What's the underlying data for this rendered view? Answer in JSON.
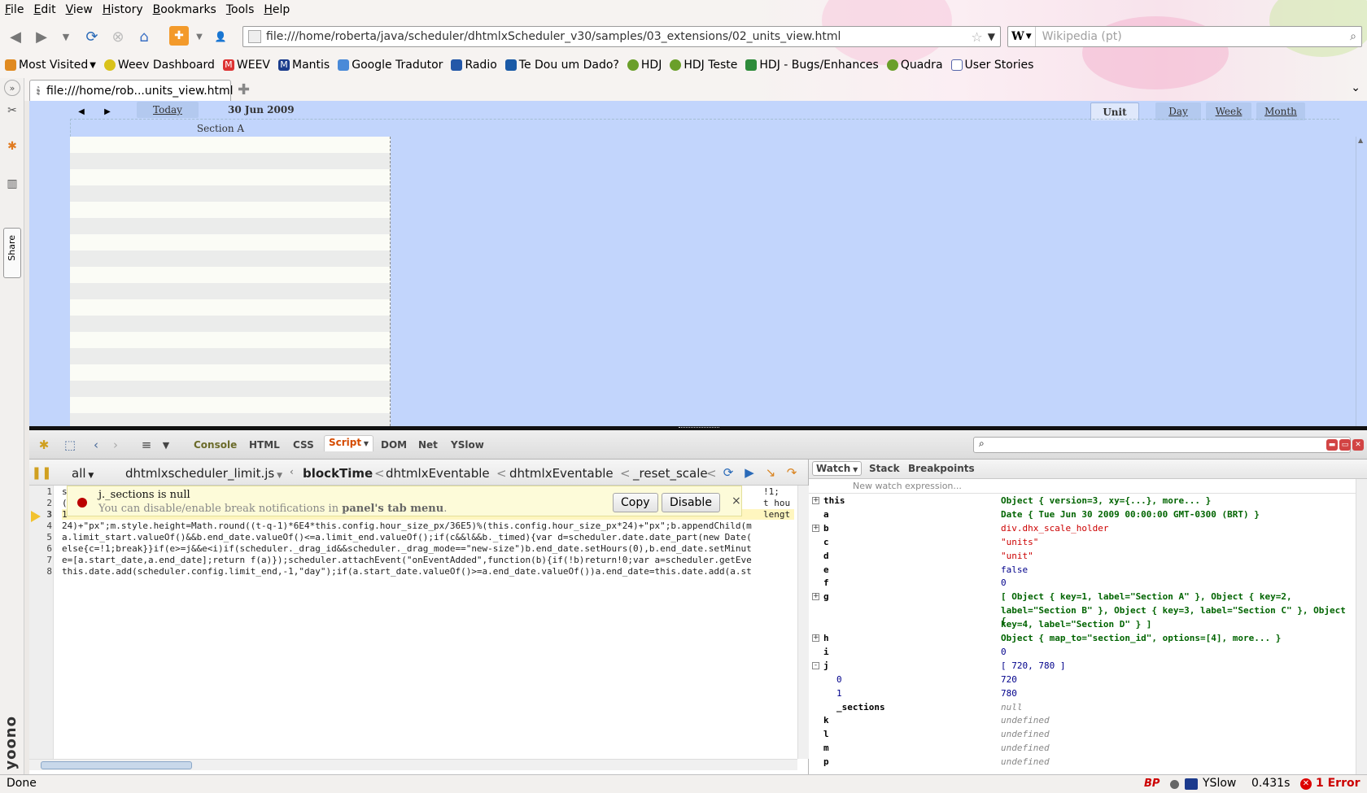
{
  "menu": [
    "File",
    "Edit",
    "View",
    "History",
    "Bookmarks",
    "Tools",
    "Help"
  ],
  "urlbar": {
    "url": "file:///home/roberta/java/scheduler/dhtmlxScheduler_v30/samples/03_extensions/02_units_view.html"
  },
  "search": {
    "engine": "W",
    "placeholder": "Wikipedia (pt)"
  },
  "bookmarks": [
    "Most Visited",
    "Weev Dashboard",
    "WEEV",
    "Mantis",
    "Google Tradutor",
    "Radio",
    "Te Dou um Dado?",
    "HDJ",
    "HDJ Teste",
    "HDJ - Bugs/Enhances",
    "Quadra",
    "User Stories"
  ],
  "tab": {
    "title": "file:///home/rob...units_view.html"
  },
  "sidebar": {
    "share_label": "Share",
    "brand": "yoono"
  },
  "scheduler": {
    "today_label": "Today",
    "date_label": "30 Jun 2009",
    "views": [
      "Unit",
      "Day",
      "Week",
      "Month"
    ],
    "active_view": "Unit",
    "section_label": "Section A"
  },
  "firebug": {
    "panels": [
      "Console",
      "HTML",
      "CSS",
      "Script",
      "DOM",
      "Net",
      "YSlow"
    ],
    "active_panel": "Script",
    "script_filter": "all",
    "script_file": "dhtmlxscheduler_limit.js",
    "callstack": [
      "blockTime",
      "dhtmlxEventable",
      "dhtmlxEventable",
      "_reset_scale"
    ],
    "line_numbers": [
      "1",
      "2",
      "3",
      "4",
      "5",
      "6",
      "7",
      "8"
    ],
    "code_lines": [
      "s",
      "(",
      "1",
      "24)+\"px\";m.style.height=Math.round((t-q-1)*6E4*this.config.hour_size_px/36E5)%(this.config.hour_size_px*24)+\"px\";b.appendChild(m",
      "a.limit_start.valueOf()&&b.end_date.valueOf()<=a.limit_end.valueOf();if(c&&l&&b._timed){var d=scheduler.date.date_part(new Date(",
      "else{c=!1;break}}if(e>=j&&e<i)if(scheduler._drag_id&&scheduler._drag_mode==\"new-size\")b.end_date.setHours(0),b.end_date.setMinut",
      "e=[a.start_date,a.end_date];return f(a)});scheduler.attachEvent(\"onEventAdded\",function(b){if(!b)return!0;var a=scheduler.getEve",
      "this.date.add(scheduler.config.limit_end,-1,\"day\");if(a.start_date.valueOf()>=a.end_date.valueOf())a.end_date=this.date.add(a.st"
    ],
    "code_right_fragments": [
      "!1;",
      "t hou",
      "lengt"
    ],
    "notification": {
      "message": "j._sections is null",
      "hint_prefix": "You can disable/enable break notifications in",
      "hint_bold": "panel's tab menu",
      "hint_suffix": ".",
      "copy_label": "Copy",
      "disable_label": "Disable",
      "close": "×"
    },
    "watch_tabs": [
      "Watch",
      "Stack",
      "Breakpoints"
    ],
    "new_watch_placeholder": "New watch expression...",
    "watch": [
      {
        "name": "this",
        "value": "Object { version=3,  xy={...},  more... }",
        "kind": "obj",
        "expand": "+"
      },
      {
        "name": "a",
        "value": "Date { Tue Jun 30 2009 00:00:00 GMT-0300 (BRT) }",
        "kind": "obj",
        "expand": ""
      },
      {
        "name": "b",
        "value": "div.dhx_scale_holder",
        "kind": "dom",
        "expand": "+"
      },
      {
        "name": "c",
        "value": "\"units\"",
        "kind": "str",
        "expand": ""
      },
      {
        "name": "d",
        "value": "\"unit\"",
        "kind": "str",
        "expand": ""
      },
      {
        "name": "e",
        "value": "false",
        "kind": "num",
        "expand": ""
      },
      {
        "name": "f",
        "value": "0",
        "kind": "num",
        "expand": ""
      },
      {
        "name": "g",
        "value": "[ Object { key=1,  label=\"Section A\" },  Object { key=2,",
        "kind": "obj",
        "expand": "+"
      },
      {
        "name": "",
        "value": "label=\"Section B\" },  Object { key=3,  label=\"Section C\" },  Object {",
        "kind": "obj",
        "expand": ""
      },
      {
        "name": "",
        "value": "key=4,  label=\"Section D\" } ]",
        "kind": "obj",
        "expand": ""
      },
      {
        "name": "h",
        "value": "Object { map_to=\"section_id\",  options=[4],  more... }",
        "kind": "obj",
        "expand": "+"
      },
      {
        "name": "i",
        "value": "0",
        "kind": "num",
        "expand": ""
      },
      {
        "name": "j",
        "value": "[ 720,  780 ]",
        "kind": "num",
        "expand": "-"
      },
      {
        "name": "0",
        "value": "720",
        "kind": "num",
        "expand": "",
        "indent": true
      },
      {
        "name": "1",
        "value": "780",
        "kind": "num",
        "expand": "",
        "indent": true
      },
      {
        "name": "_sections",
        "value": "null",
        "kind": "nul",
        "expand": "",
        "indent": true
      },
      {
        "name": "k",
        "value": "undefined",
        "kind": "nul",
        "expand": ""
      },
      {
        "name": "l",
        "value": "undefined",
        "kind": "nul",
        "expand": ""
      },
      {
        "name": "m",
        "value": "undefined",
        "kind": "nul",
        "expand": ""
      },
      {
        "name": "p",
        "value": "undefined",
        "kind": "nul",
        "expand": ""
      }
    ]
  },
  "status": {
    "text": "Done",
    "bp": "BP",
    "yslow": "YSlow",
    "time": "0.431s",
    "errors": "1 Error"
  }
}
